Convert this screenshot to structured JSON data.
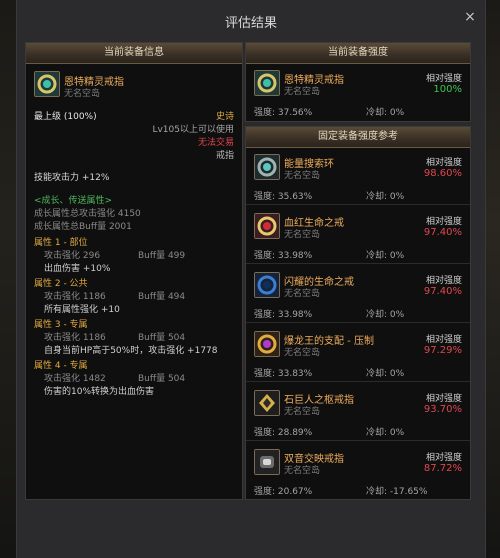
{
  "dialog": {
    "title": "评估结果",
    "close": "×"
  },
  "left_panel": {
    "header": "当前装备信息",
    "item": {
      "name": "恩特精灵戒指",
      "sub": "无名空岛"
    },
    "level": "最上级 (100%)",
    "rarity": "史诗",
    "usage": "Lv105以上可以使用",
    "trade": "无法交易",
    "type": "戒指",
    "skill": "技能攻击力 +12%",
    "growth_header": "<成长、传送属性>",
    "growth_total_attack": "成长属性总攻击强化 4150",
    "growth_total_buff": "成长属性总Buff量 2001",
    "attrs": [
      {
        "title": "属性 1 - 部位",
        "attack": "攻击强化  296",
        "buff": "Buff量  499",
        "effect": "出血伤害 +10%"
      },
      {
        "title": "属性 2 - 公共",
        "attack": "攻击强化  1186",
        "buff": "Buff量  494",
        "effect": "所有属性强化 +10"
      },
      {
        "title": "属性 3 - 专属",
        "attack": "攻击强化  1186",
        "buff": "Buff量  504",
        "effect": "自身当前HP高于50%时，攻击强化 +1778"
      },
      {
        "title": "属性 4 - 专属",
        "attack": "攻击强化  1482",
        "buff": "Buff量  504",
        "effect": "伤害的10%转换为出血伤害"
      }
    ]
  },
  "current_panel": {
    "header": "当前装备强度",
    "item": {
      "name": "恩特精灵戒指",
      "sub": "无名空岛",
      "rel_label": "相对强度",
      "rel_value": "100%",
      "strength": "强度: 37.56%",
      "cooldown": "冷却: 0%"
    }
  },
  "reference_panel": {
    "header": "固定装备强度参考",
    "items": [
      {
        "name": "能量搜索环",
        "sub": "无名空岛",
        "rel_label": "相对强度",
        "rel_value": "98.60%",
        "strength": "强度: 35.63%",
        "cooldown": "冷却: 0%",
        "icon": "teal-ring-icon"
      },
      {
        "name": "血红生命之戒",
        "sub": "无名空岛",
        "rel_label": "相对强度",
        "rel_value": "97.40%",
        "strength": "强度: 33.98%",
        "cooldown": "冷却: 0%",
        "icon": "crimson-ring-icon"
      },
      {
        "name": "闪耀的生命之戒",
        "sub": "无名空岛",
        "rel_label": "相对强度",
        "rel_value": "97.40%",
        "strength": "强度: 33.98%",
        "cooldown": "冷却: 0%",
        "icon": "blue-ring-icon"
      },
      {
        "name": "爆龙王的支配 - 压制",
        "sub": "无名空岛",
        "rel_label": "相对强度",
        "rel_value": "97.29%",
        "strength": "强度: 33.83%",
        "cooldown": "冷却: 0%",
        "icon": "dragon-ring-icon"
      },
      {
        "name": "石巨人之枢戒指",
        "sub": "无名空岛",
        "rel_label": "相对强度",
        "rel_value": "93.70%",
        "strength": "强度: 28.89%",
        "cooldown": "冷却: 0%",
        "icon": "golem-ring-icon"
      },
      {
        "name": "双音交映戒指",
        "sub": "无名空岛",
        "rel_label": "相对强度",
        "rel_value": "87.72%",
        "strength": "强度: 20.67%",
        "cooldown": "冷却: -17.65%",
        "icon": "dual-tone-ring-icon"
      }
    ]
  },
  "colors": {
    "rel_top": "#3fc24e",
    "rel_other": "#e0474c",
    "item_name": "#efad5b",
    "epic": "#e2ab3f",
    "untradable": "#e0474c",
    "growth": "#4fb85d"
  }
}
